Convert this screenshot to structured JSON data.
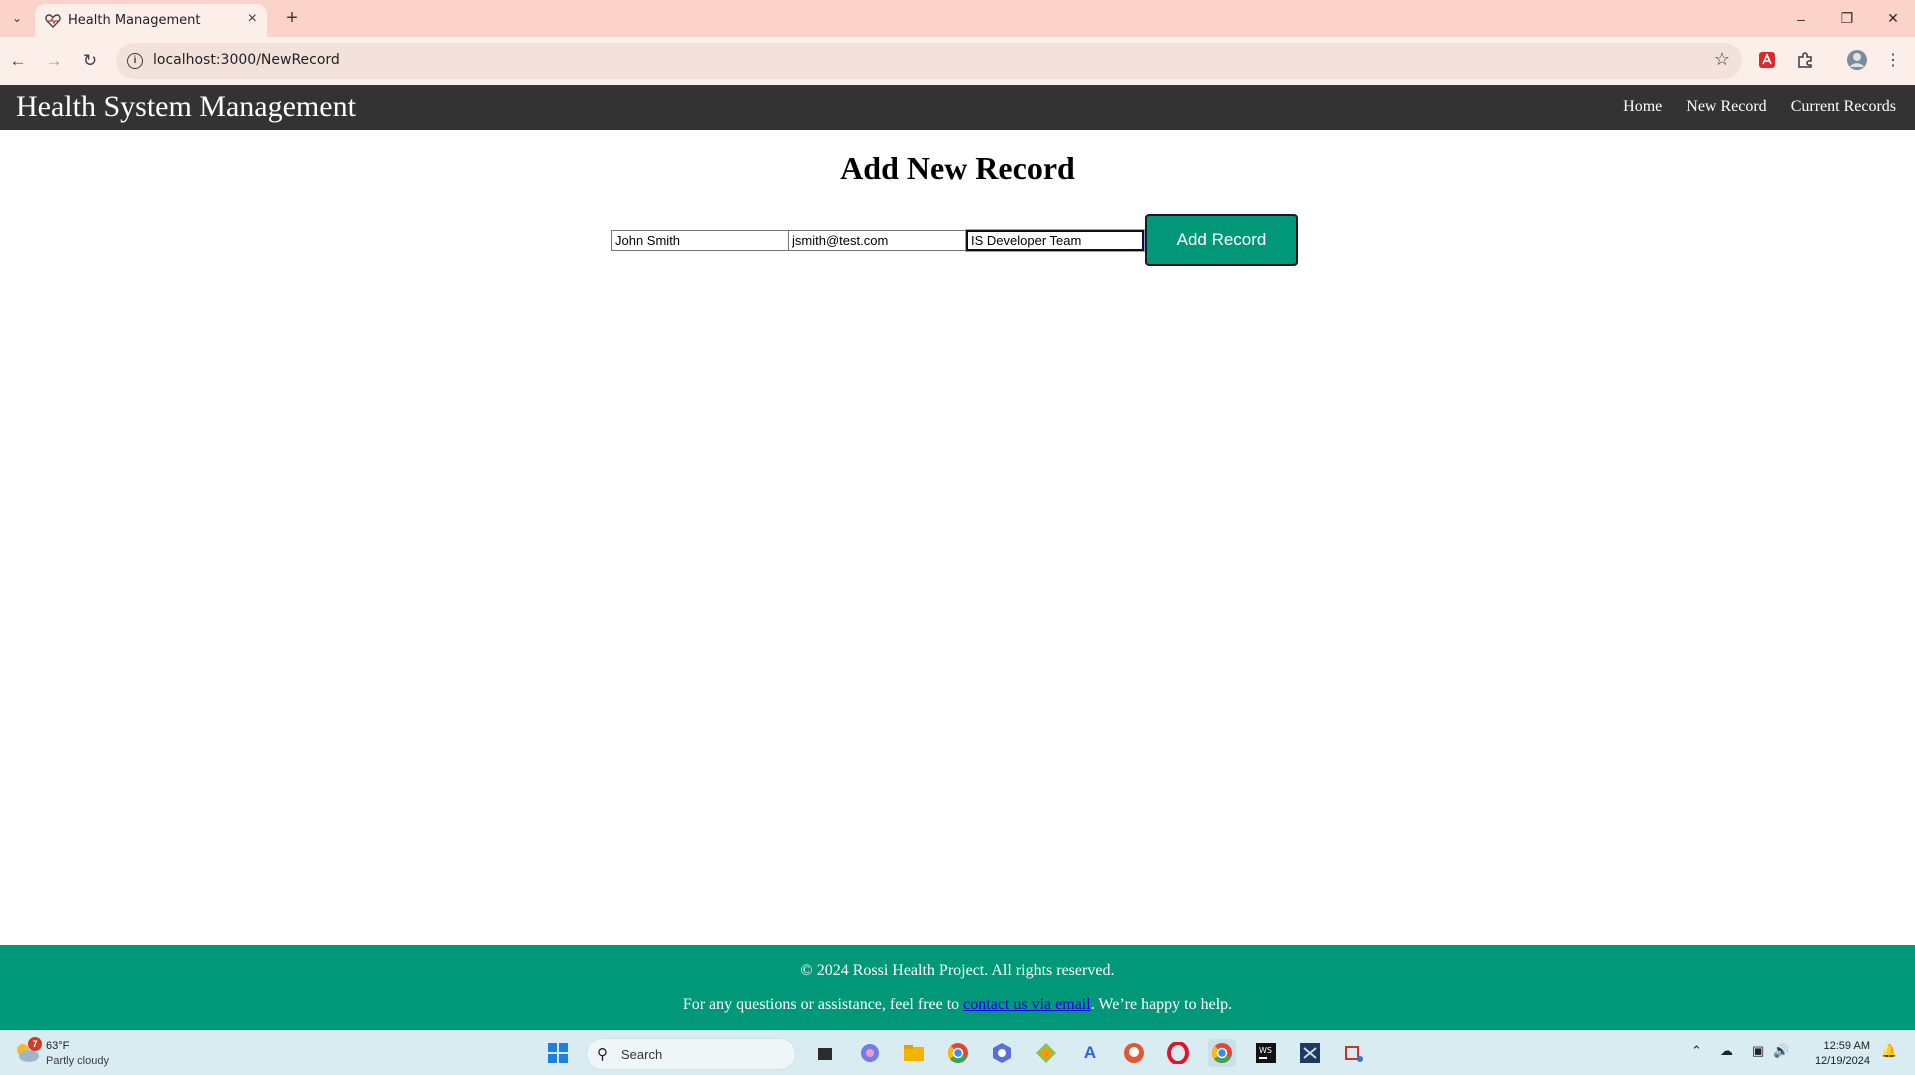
{
  "browser": {
    "tab_title": "Health Management",
    "url": "localhost:3000/NewRecord"
  },
  "app": {
    "title": "Health System Management",
    "nav": [
      "Home",
      "New Record",
      "Current Records"
    ]
  },
  "page": {
    "heading": "Add New Record"
  },
  "form": {
    "name_value": "John Smith",
    "email_value": "jsmith@test.com",
    "team_value": "IS Developer Team",
    "submit_label": "Add Record"
  },
  "footer": {
    "copyright": "© 2024 Rossi Health Project. All rights reserved.",
    "help_prefix": "For any questions or assistance, feel free to ",
    "help_link": "contact us via email",
    "help_suffix": ". We’re happy to help."
  },
  "taskbar": {
    "weather_badge": "7",
    "weather_temp": "63°F",
    "weather_desc": "Partly cloudy",
    "search_label": "Search",
    "time": "12:59 AM",
    "date": "12/19/2024"
  },
  "colors": {
    "appbar": "#333333",
    "accent": "#009879",
    "tabbar": "#fbd3c9"
  }
}
